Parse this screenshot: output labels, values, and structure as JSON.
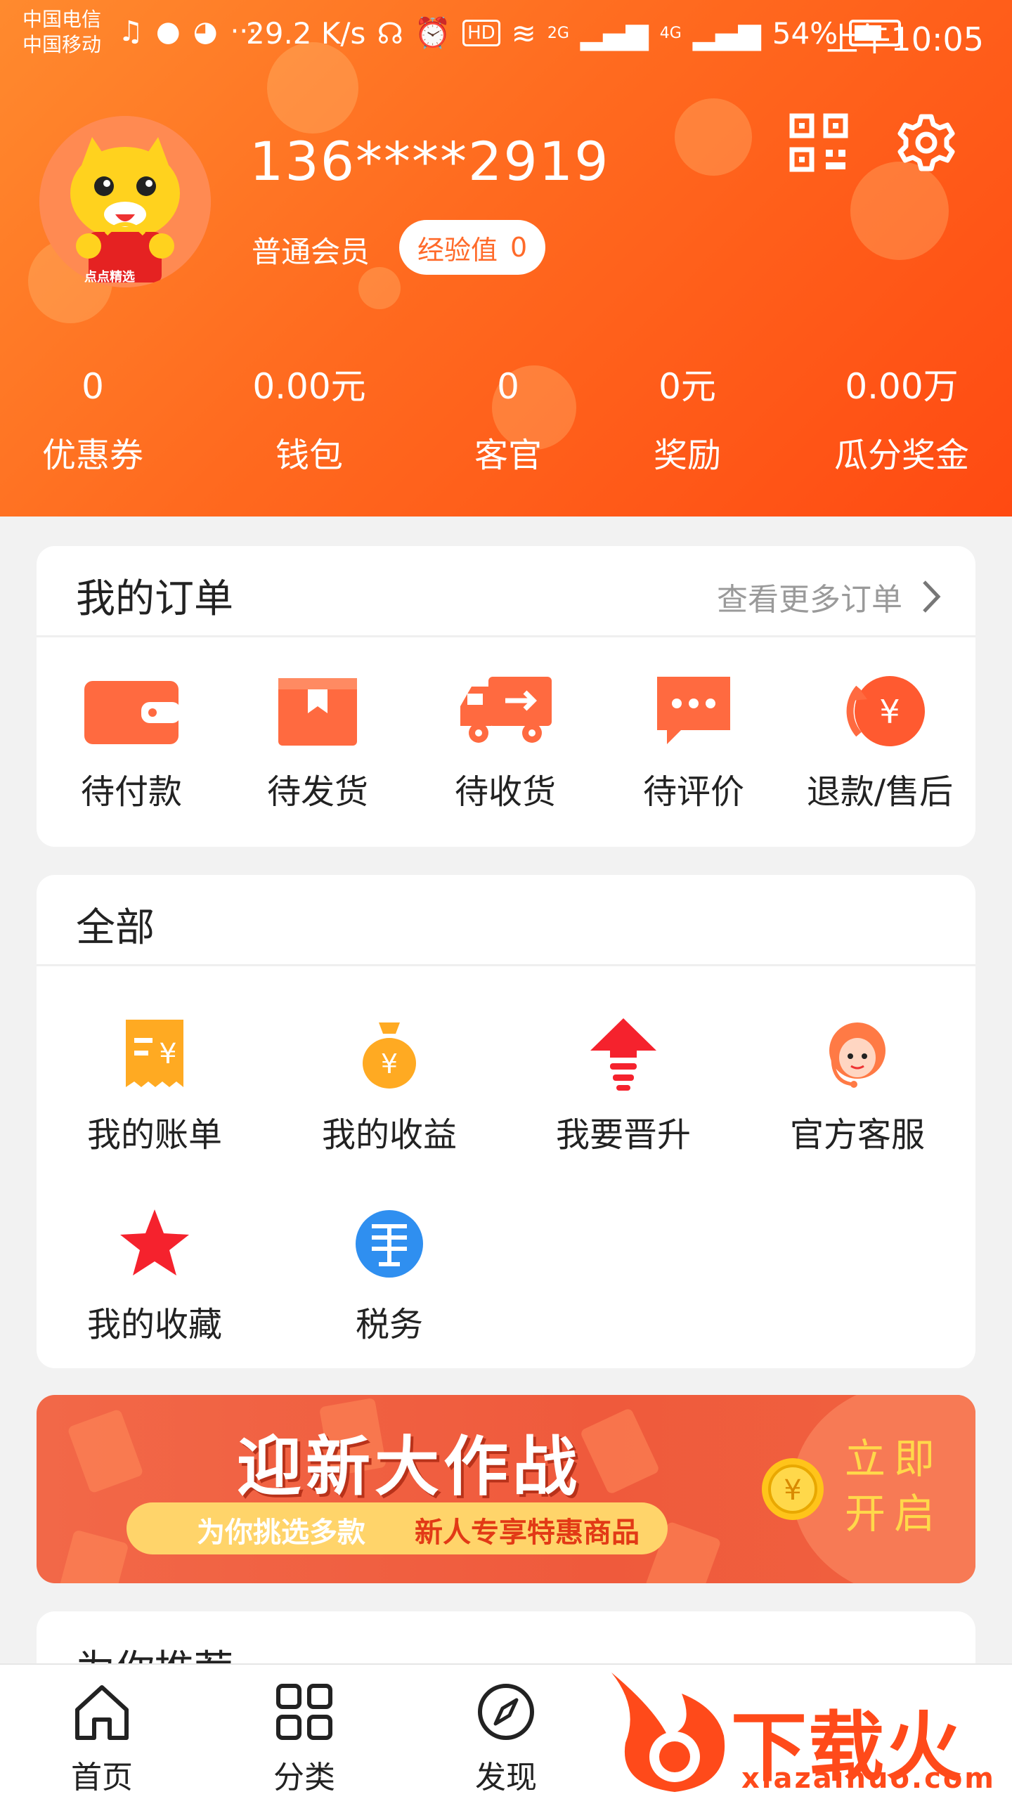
{
  "status_bar": {
    "carrier_1": "中国电信",
    "carrier_2": "中国移动",
    "net_speed": "29.2 K/s",
    "hd_badge": "HD",
    "signal_1": "2G",
    "signal_2": "4G",
    "battery": "54%",
    "time": "上午10:05"
  },
  "profile": {
    "avatar_caption": "点点精选",
    "phone": "136****2919",
    "member_level": "普通会员",
    "exp_label": "经验值",
    "exp_value": "0"
  },
  "header_icons": [
    "qr-code-icon",
    "settings-gear-icon"
  ],
  "stats": [
    {
      "value": "0",
      "label": "优惠券"
    },
    {
      "value": "0.00元",
      "label": "钱包"
    },
    {
      "value": "0",
      "label": "客官"
    },
    {
      "value": "0元",
      "label": "奖励"
    },
    {
      "value": "0.00万",
      "label": "瓜分奖金"
    }
  ],
  "orders": {
    "title": "我的订单",
    "more_label": "查看更多订单",
    "items": [
      {
        "label": "待付款",
        "icon": "wallet-icon"
      },
      {
        "label": "待发货",
        "icon": "package-icon"
      },
      {
        "label": "待收货",
        "icon": "truck-icon"
      },
      {
        "label": "待评价",
        "icon": "comment-icon"
      },
      {
        "label": "退款/售后",
        "icon": "refund-icon"
      }
    ]
  },
  "tools": {
    "title": "全部",
    "items": [
      {
        "label": "我的账单",
        "icon": "bill-icon"
      },
      {
        "label": "我的收益",
        "icon": "money-bag-icon"
      },
      {
        "label": "我要晋升",
        "icon": "upgrade-arrow-icon"
      },
      {
        "label": "官方客服",
        "icon": "customer-service-icon"
      },
      {
        "label": "我的收藏",
        "icon": "star-icon"
      },
      {
        "label": "税务",
        "icon": "tax-icon"
      }
    ]
  },
  "promo": {
    "title": "迎新大作战",
    "subtitle_a": "为你挑选多款",
    "subtitle_b": "新人专享特惠商品",
    "cta_line1": "立即",
    "cta_line2": "开启"
  },
  "recommend": {
    "title": "为你推荐"
  },
  "bottom_nav": [
    {
      "label": "首页",
      "icon": "home-icon"
    },
    {
      "label": "分类",
      "icon": "category-grid-icon"
    },
    {
      "label": "发现",
      "icon": "compass-icon"
    }
  ],
  "watermark": {
    "text": "下载火",
    "sub": "xiazaihuo.com"
  },
  "colors": {
    "brand_orange": "#ff6a1f",
    "icon_orange": "#ff6a40",
    "promo_red": "#ef5a3c",
    "cta_yellow": "#ffd84a"
  }
}
